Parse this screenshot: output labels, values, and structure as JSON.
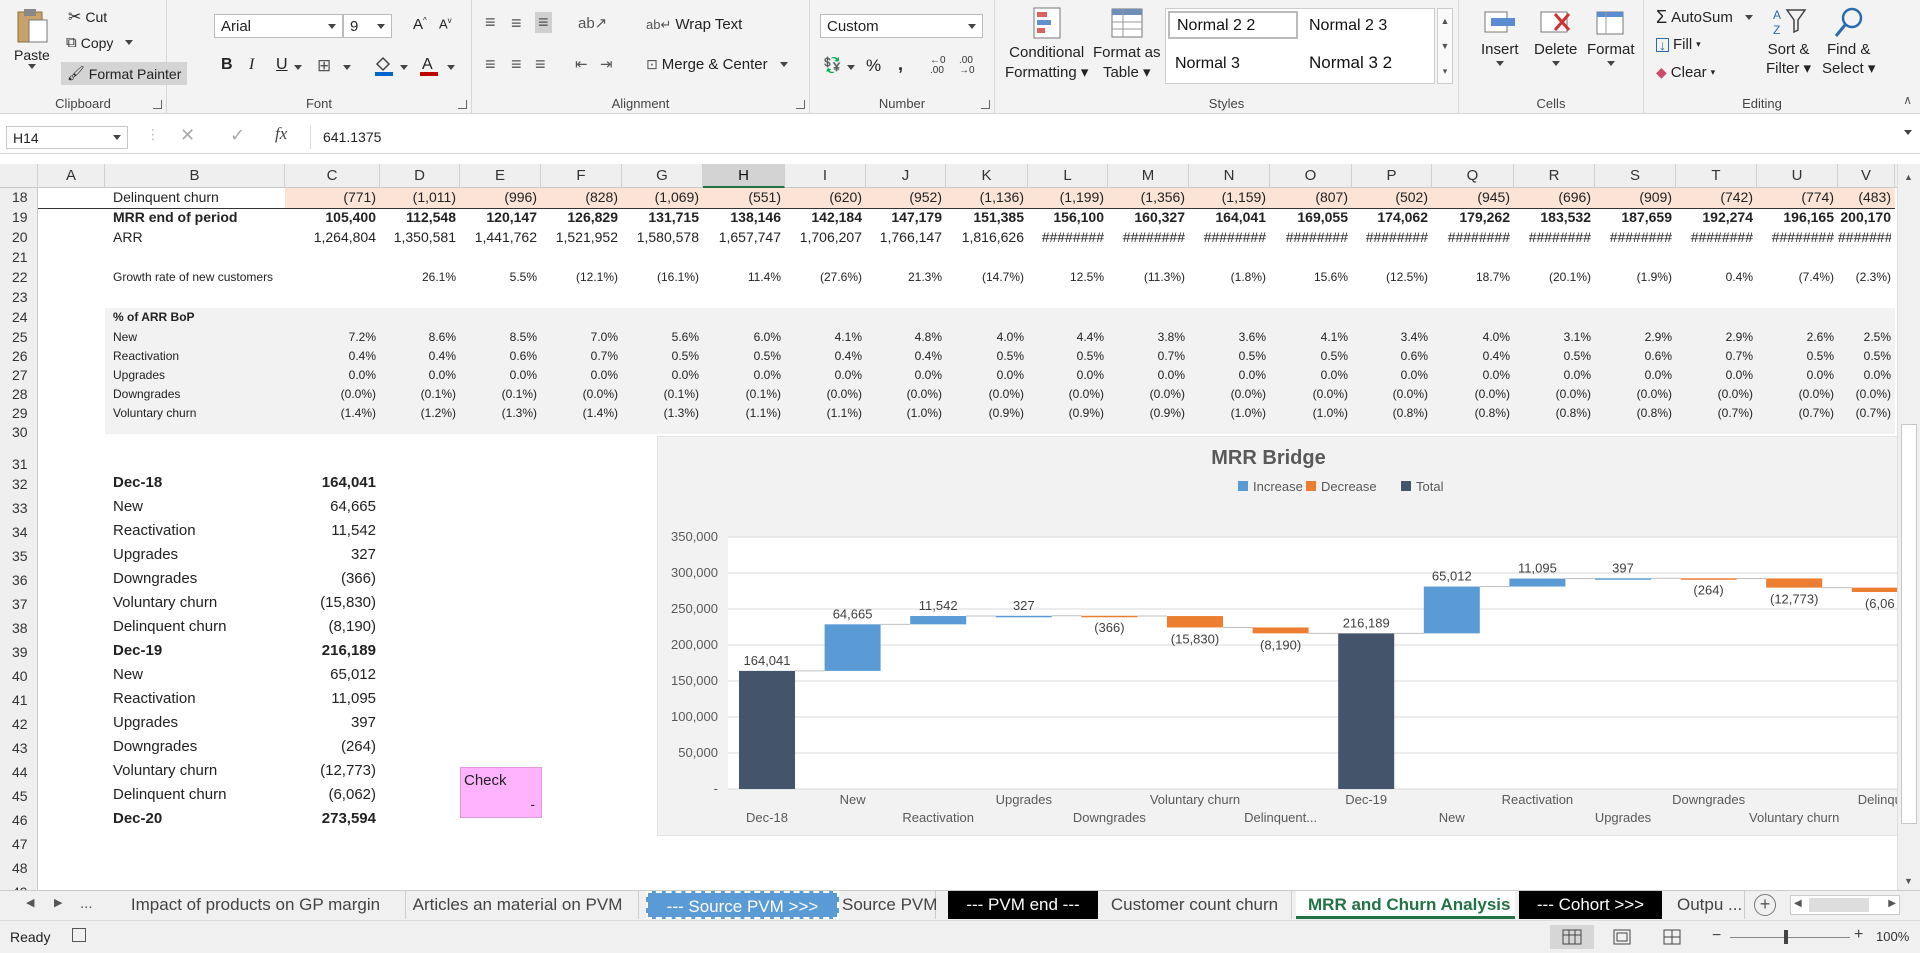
{
  "ribbon": {
    "clipboard": {
      "paste": "Paste",
      "cut": "Cut",
      "copy": "Copy",
      "format_painter": "Format Painter",
      "label": "Clipboard"
    },
    "font": {
      "name": "Arial",
      "size": "9",
      "bold": "B",
      "italic": "I",
      "underline": "U",
      "label": "Font"
    },
    "alignment": {
      "wrap_text": "Wrap Text",
      "merge_center": "Merge & Center",
      "label": "Alignment"
    },
    "number": {
      "format": "Custom",
      "percent": "%",
      "comma": ",",
      "label": "Number"
    },
    "styles": {
      "conditional": "Conditional",
      "conditional2": "Formatting",
      "format_as": "Format as",
      "format_as2": "Table",
      "cells": [
        "Normal 2 2",
        "Normal 2 3",
        "Normal 3",
        "Normal 3 2"
      ],
      "label": "Styles"
    },
    "cells": {
      "insert": "Insert",
      "delete": "Delete",
      "format": "Format",
      "label": "Cells"
    },
    "editing": {
      "autosum": "AutoSum",
      "fill": "Fill",
      "clear": "Clear",
      "sort": "Sort &",
      "sort2": "Filter",
      "find": "Find &",
      "find2": "Select",
      "label": "Editing"
    }
  },
  "formula_bar": {
    "name_box": "H14",
    "fx": "fx",
    "value": "641.1375"
  },
  "columns": [
    "A",
    "B",
    "C",
    "D",
    "E",
    "F",
    "G",
    "H",
    "I",
    "J",
    "K",
    "L",
    "M",
    "N",
    "O",
    "P",
    "Q",
    "R",
    "S",
    "T",
    "U",
    "V"
  ],
  "selected_column": "H",
  "rows": [
    "18",
    "19",
    "20",
    "21",
    "22",
    "23",
    "24",
    "25",
    "26",
    "27",
    "28",
    "29",
    "30",
    "31",
    "32",
    "33",
    "34",
    "35",
    "36",
    "37",
    "38",
    "39",
    "40",
    "41",
    "42",
    "43",
    "44",
    "45",
    "46",
    "47",
    "48",
    "49"
  ],
  "table": {
    "delinquent": {
      "label": "Delinquent churn",
      "values": [
        "(771)",
        "(1,011)",
        "(996)",
        "(828)",
        "(1,069)",
        "(551)",
        "(620)",
        "(952)",
        "(1,136)",
        "(1,199)",
        "(1,356)",
        "(1,159)",
        "(807)",
        "(502)",
        "(945)",
        "(696)",
        "(909)",
        "(742)",
        "(774)",
        "(483)"
      ]
    },
    "mrr_end": {
      "label": "MRR end of period",
      "values": [
        "105,400",
        "112,548",
        "120,147",
        "126,829",
        "131,715",
        "138,146",
        "142,184",
        "147,179",
        "151,385",
        "156,100",
        "160,327",
        "164,041",
        "169,055",
        "174,062",
        "179,262",
        "183,532",
        "187,659",
        "192,274",
        "196,165",
        "200,170"
      ]
    },
    "arr": {
      "label": "ARR",
      "values": [
        "1,264,804",
        "1,350,581",
        "1,441,762",
        "1,521,952",
        "1,580,578",
        "1,657,747",
        "1,706,207",
        "1,766,147",
        "1,816,626",
        "########",
        "########",
        "########",
        "########",
        "########",
        "########",
        "########",
        "########",
        "########",
        "########",
        "########"
      ]
    },
    "growth": {
      "label": "Growth rate of new customers",
      "values": [
        "",
        "26.1%",
        "5.5%",
        "(12.1%)",
        "(16.1%)",
        "11.4%",
        "(27.6%)",
        "21.3%",
        "(14.7%)",
        "12.5%",
        "(11.3%)",
        "(1.8%)",
        "15.6%",
        "(12.5%)",
        "18.7%",
        "(20.1%)",
        "(1.9%)",
        "0.4%",
        "(7.4%)",
        "(2.3%)"
      ]
    },
    "pct_header": "% of ARR BoP",
    "pct_rows": [
      {
        "label": "New",
        "values": [
          "7.2%",
          "8.6%",
          "8.5%",
          "7.0%",
          "5.6%",
          "6.0%",
          "4.1%",
          "4.8%",
          "4.0%",
          "4.4%",
          "3.8%",
          "3.6%",
          "4.1%",
          "3.4%",
          "4.0%",
          "3.1%",
          "2.9%",
          "2.9%",
          "2.6%",
          "2.5%"
        ]
      },
      {
        "label": "Reactivation",
        "values": [
          "0.4%",
          "0.4%",
          "0.6%",
          "0.7%",
          "0.5%",
          "0.5%",
          "0.4%",
          "0.4%",
          "0.5%",
          "0.5%",
          "0.7%",
          "0.5%",
          "0.5%",
          "0.6%",
          "0.4%",
          "0.5%",
          "0.6%",
          "0.7%",
          "0.5%",
          "0.5%"
        ]
      },
      {
        "label": "Upgrades",
        "values": [
          "0.0%",
          "0.0%",
          "0.0%",
          "0.0%",
          "0.0%",
          "0.0%",
          "0.0%",
          "0.0%",
          "0.0%",
          "0.0%",
          "0.0%",
          "0.0%",
          "0.0%",
          "0.0%",
          "0.0%",
          "0.0%",
          "0.0%",
          "0.0%",
          "0.0%",
          "0.0%"
        ]
      },
      {
        "label": "Downgrades",
        "values": [
          "(0.0%)",
          "(0.1%)",
          "(0.1%)",
          "(0.0%)",
          "(0.1%)",
          "(0.1%)",
          "(0.0%)",
          "(0.0%)",
          "(0.0%)",
          "(0.0%)",
          "(0.0%)",
          "(0.0%)",
          "(0.0%)",
          "(0.0%)",
          "(0.0%)",
          "(0.0%)",
          "(0.0%)",
          "(0.0%)",
          "(0.0%)",
          "(0.0%)"
        ]
      },
      {
        "label": "Voluntary churn",
        "values": [
          "(1.4%)",
          "(1.2%)",
          "(1.3%)",
          "(1.4%)",
          "(1.3%)",
          "(1.1%)",
          "(1.1%)",
          "(1.0%)",
          "(0.9%)",
          "(0.9%)",
          "(0.9%)",
          "(1.0%)",
          "(1.0%)",
          "(0.8%)",
          "(0.8%)",
          "(0.8%)",
          "(0.8%)",
          "(0.7%)",
          "(0.7%)",
          "(0.7%)"
        ]
      }
    ],
    "bridge": [
      {
        "label": "Dec-18",
        "value": "164,041",
        "bold": true
      },
      {
        "label": "New",
        "value": "64,665"
      },
      {
        "label": "Reactivation",
        "value": "11,542"
      },
      {
        "label": "Upgrades",
        "value": "327"
      },
      {
        "label": "Downgrades",
        "value": "(366)"
      },
      {
        "label": "Voluntary churn",
        "value": "(15,830)"
      },
      {
        "label": "Delinquent churn",
        "value": "(8,190)"
      },
      {
        "label": "Dec-19",
        "value": "216,189",
        "bold": true
      },
      {
        "label": "New",
        "value": "65,012"
      },
      {
        "label": "Reactivation",
        "value": "11,095"
      },
      {
        "label": "Upgrades",
        "value": "397"
      },
      {
        "label": "Downgrades",
        "value": "(264)"
      },
      {
        "label": "Voluntary churn",
        "value": "(12,773)"
      },
      {
        "label": "Delinquent churn",
        "value": "(6,062)"
      },
      {
        "label": "Dec-20",
        "value": "273,594",
        "bold": true
      }
    ],
    "check_label": "Check",
    "check_value": "-"
  },
  "chart_data": {
    "type": "bar",
    "title": "MRR Bridge",
    "legend": [
      "Increase",
      "Decrease",
      "Total"
    ],
    "legend_position": "top",
    "colors": {
      "Increase": "#5b9bd5",
      "Decrease": "#ed7d31",
      "Total": "#44546a"
    },
    "ylim": [
      0,
      350000
    ],
    "yticks": [
      "350,000",
      "300,000",
      "250,000",
      "200,000",
      "150,000",
      "100,000",
      "50,000",
      "-"
    ],
    "categories": [
      "Dec-18",
      "New",
      "Reactivation",
      "Upgrades",
      "Downgrades",
      "Voluntary churn",
      "Delinquent...",
      "Dec-19",
      "New",
      "Reactivation",
      "Upgrades",
      "Downgrades",
      "Voluntary churn",
      "Delinqu"
    ],
    "bars": [
      {
        "kind": "Total",
        "start": 0,
        "end": 164041,
        "label": "164,041"
      },
      {
        "kind": "Increase",
        "start": 164041,
        "end": 228706,
        "label": "64,665"
      },
      {
        "kind": "Increase",
        "start": 228706,
        "end": 240248,
        "label": "11,542"
      },
      {
        "kind": "Increase",
        "start": 240248,
        "end": 240575,
        "label": "327"
      },
      {
        "kind": "Decrease",
        "start": 240575,
        "end": 240209,
        "label": "(366)"
      },
      {
        "kind": "Decrease",
        "start": 240209,
        "end": 224379,
        "label": "(15,830)"
      },
      {
        "kind": "Decrease",
        "start": 224379,
        "end": 216189,
        "label": "(8,190)"
      },
      {
        "kind": "Total",
        "start": 0,
        "end": 216189,
        "label": "216,189"
      },
      {
        "kind": "Increase",
        "start": 216189,
        "end": 281201,
        "label": "65,012"
      },
      {
        "kind": "Increase",
        "start": 281201,
        "end": 292296,
        "label": "11,095"
      },
      {
        "kind": "Increase",
        "start": 292296,
        "end": 292693,
        "label": "397"
      },
      {
        "kind": "Decrease",
        "start": 292693,
        "end": 292429,
        "label": "(264)"
      },
      {
        "kind": "Decrease",
        "start": 292429,
        "end": 279656,
        "label": "(12,773)"
      },
      {
        "kind": "Decrease",
        "start": 279656,
        "end": 273594,
        "label": "(6,06"
      }
    ],
    "grid": true
  },
  "sheet_tabs": [
    "Impact of products on GP margin",
    "Articles an material on PVM",
    "--- Source PVM >>>",
    "Source PVM",
    "--- PVM end ---",
    "Customer count churn",
    "MRR and Churn Analysis",
    "--- Cohort >>>",
    "Outpu ..."
  ],
  "active_tab": "MRR and Churn Analysis",
  "tab_nav": [
    "◀",
    "▶",
    "..."
  ],
  "status": {
    "ready": "Ready",
    "zoom": "100%"
  }
}
